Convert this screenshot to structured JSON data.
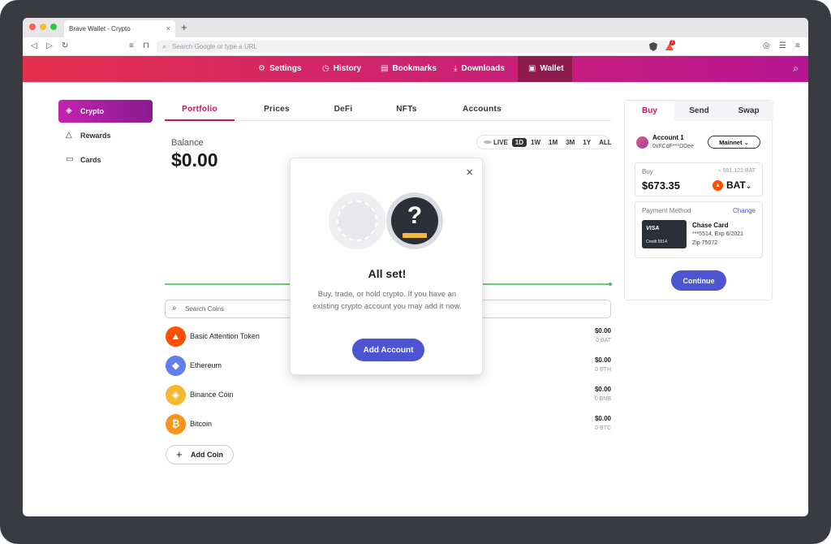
{
  "browser": {
    "tab_title": "Brave Wallet - Crypto",
    "tab_close": "×",
    "new_tab": "+",
    "url_placeholder": "Search Google or type a URL",
    "shields_badge": "2"
  },
  "topnav": {
    "items": [
      {
        "label": "Settings",
        "icon": "⚙"
      },
      {
        "label": "History",
        "icon": "◷"
      },
      {
        "label": "Bookmarks",
        "icon": "▤"
      },
      {
        "label": "Downloads",
        "icon": "⤓"
      },
      {
        "label": "Wallet",
        "icon": "▣"
      }
    ],
    "search_icon": "⌕"
  },
  "sidebar": {
    "items": [
      {
        "label": "Crypto",
        "icon": "◈"
      },
      {
        "label": "Rewards",
        "icon": "△"
      },
      {
        "label": "Cards",
        "icon": "▭"
      }
    ]
  },
  "content_tabs": [
    "Portfolio",
    "Prices",
    "DeFi",
    "NFTs",
    "Accounts"
  ],
  "portfolio": {
    "balance_label": "Balance",
    "balance_value": "$0.00",
    "ranges": [
      "LIVE",
      "1D",
      "1W",
      "1M",
      "3M",
      "1Y",
      "ALL"
    ],
    "selected_range": "1D",
    "search_placeholder": "Search Coins",
    "coins": [
      {
        "name": "Basic Attention Token",
        "fiat": "$0.00",
        "amount": "0 BAT",
        "color": "#ff5000",
        "glyph": "▲"
      },
      {
        "name": "Ethereum",
        "fiat": "$0.00",
        "amount": "0 ETH",
        "color": "#627eea",
        "glyph": "◆"
      },
      {
        "name": "Binance Coin",
        "fiat": "$0.00",
        "amount": "0 BNB",
        "color": "#f3ba2f",
        "glyph": "◈"
      },
      {
        "name": "Bitcoin",
        "fiat": "$0.00",
        "amount": "0 BTC",
        "color": "#f7931a",
        "glyph": "₿"
      }
    ],
    "add_coin_label": "Add Coin",
    "add_coin_icon": "+"
  },
  "buy_panel": {
    "tabs": [
      "Buy",
      "Send",
      "Swap"
    ],
    "account_name": "Account 1",
    "account_address": "0xFCdF***DDee",
    "network": "Mainnet",
    "network_chevron": "⌄",
    "buy_label": "Buy",
    "buy_bat_estimate": "≈ 561.121 BAT",
    "buy_usd": "$673.35",
    "asset_symbol": "BAT",
    "asset_chevron": "⌄",
    "payment_method_label": "Payment Method",
    "change_label": "Change",
    "card": {
      "brand": "VISA",
      "card_type": "Credit 5514",
      "name": "Chase Card",
      "line1": "***5514, Exp 6/2021",
      "line2": "Zip 75072"
    },
    "continue_label": "Continue"
  },
  "modal": {
    "close": "×",
    "title": "All set!",
    "text": "Buy, trade, or hold crypto. If you have an existing crypto account you may add it now.",
    "question_glyph": "?",
    "button_label": "Add Account"
  },
  "colors": {
    "accent_pink": "#c2185b",
    "accent_blue": "#4c54d2",
    "chart_green": "#6cd07a"
  }
}
